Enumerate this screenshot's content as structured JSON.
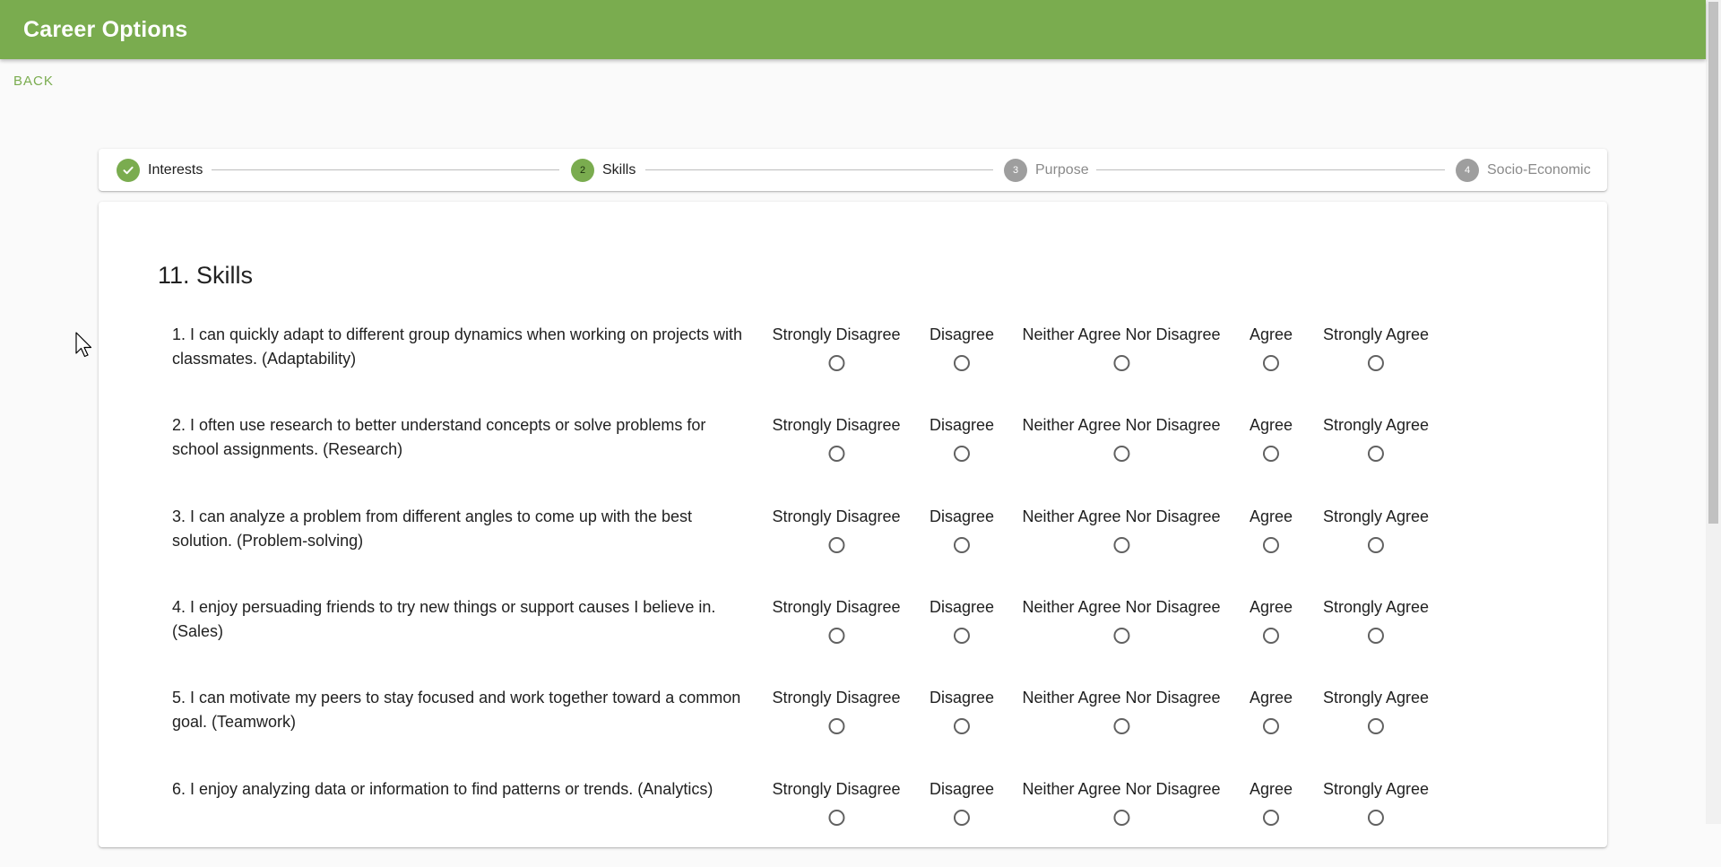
{
  "app": {
    "title": "Career Options",
    "accent_color": "#7aac4f"
  },
  "nav": {
    "back_label": "BACK"
  },
  "stepper": {
    "steps": [
      {
        "label": "Interests",
        "number": "1",
        "state": "completed",
        "icon": "check-icon"
      },
      {
        "label": "Skills",
        "number": "2",
        "state": "active"
      },
      {
        "label": "Purpose",
        "number": "3",
        "state": "pending"
      },
      {
        "label": "Socio-Economic",
        "number": "4",
        "state": "pending"
      }
    ]
  },
  "section": {
    "title": "11. Skills"
  },
  "scale_options": [
    "Strongly Disagree",
    "Disagree",
    "Neither Agree Nor Disagree",
    "Agree",
    "Strongly Agree"
  ],
  "questions": [
    {
      "text": "1. I can quickly adapt to different group dynamics when working on projects with classmates. (Adaptability)"
    },
    {
      "text": "2. I often use research to better understand concepts or solve problems for school assignments. (Research)"
    },
    {
      "text": "3. I can analyze a problem from different angles to come up with the best solution. (Problem-solving)"
    },
    {
      "text": "4. I enjoy persuading friends to try new things or support causes I believe in. (Sales)"
    },
    {
      "text": "5. I can motivate my peers to stay focused and work together toward a common goal. (Teamwork)"
    },
    {
      "text": "6. I enjoy analyzing data or information to find patterns or trends. (Analytics)"
    }
  ]
}
